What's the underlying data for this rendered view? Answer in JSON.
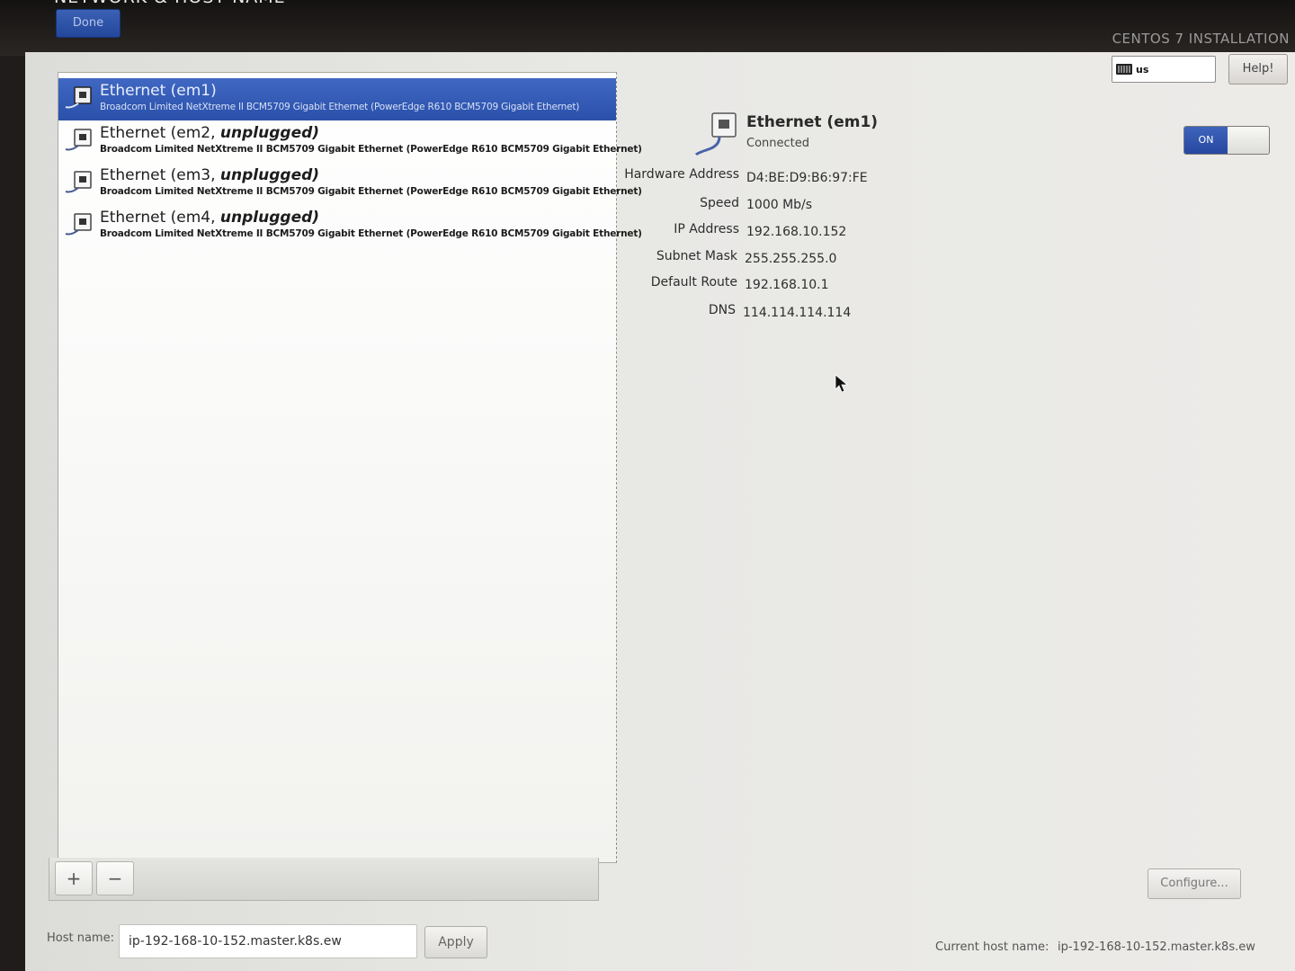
{
  "header": {
    "page_title": "NETWORK & HOST NAME",
    "done_label": "Done",
    "product_title": "CENTOS 7 INSTALLATION",
    "keyboard_layout": "us",
    "help_label": "Help!"
  },
  "devices": [
    {
      "name": "Ethernet (em1)",
      "state": "",
      "description": "Broadcom Limited NetXtreme II BCM5709 Gigabit Ethernet (PowerEdge R610 BCM5709 Gigabit Ethernet)",
      "icon": "ethernet-icon",
      "selected": true
    },
    {
      "name": "Ethernet (em2, ",
      "state": "unplugged)",
      "description": "Broadcom Limited NetXtreme II BCM5709 Gigabit Ethernet (PowerEdge R610 BCM5709 Gigabit Ethernet)",
      "icon": "ethernet-icon",
      "selected": false
    },
    {
      "name": "Ethernet (em3, ",
      "state": "unplugged)",
      "description": "Broadcom Limited NetXtreme II BCM5709 Gigabit Ethernet (PowerEdge R610 BCM5709 Gigabit Ethernet)",
      "icon": "ethernet-icon",
      "selected": false
    },
    {
      "name": "Ethernet (em4, ",
      "state": "unplugged)",
      "description": "Broadcom Limited NetXtreme II BCM5709 Gigabit Ethernet (PowerEdge R610 BCM5709 Gigabit Ethernet)",
      "icon": "ethernet-icon",
      "selected": false
    }
  ],
  "list_toolbar": {
    "add_label": "+",
    "remove_label": "−"
  },
  "detail": {
    "name": "Ethernet (em1)",
    "status": "Connected",
    "toggle_label": "ON",
    "toggle_on": true,
    "properties": [
      {
        "label": "Hardware Address",
        "value": "D4:BE:D9:B6:97:FE"
      },
      {
        "label": "Speed",
        "value": "1000 Mb/s"
      },
      {
        "label": "IP Address",
        "value": "192.168.10.152"
      },
      {
        "label": "Subnet Mask",
        "value": "255.255.255.0"
      },
      {
        "label": "Default Route",
        "value": "192.168.10.1"
      },
      {
        "label": "DNS",
        "value": "114.114.114.114"
      }
    ],
    "configure_label": "Configure..."
  },
  "hostname": {
    "label": "Host name:",
    "value": "ip-192-168-10-152.master.k8s.ew",
    "apply_label": "Apply",
    "current_label": "Current host name:",
    "current_value": "ip-192-168-10-152.master.k8s.ew"
  },
  "colors": {
    "accent": "#2a50aa",
    "header_background": "#1f1c1b",
    "panel_background": "#e8e8e5"
  }
}
